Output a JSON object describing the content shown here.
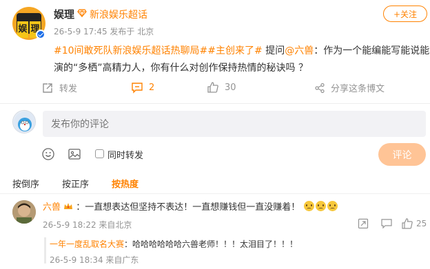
{
  "header": {
    "avatar_chars": [
      "娱",
      "理"
    ],
    "username": "娱理",
    "badge": "新浪娱乐超话",
    "meta": "26-5-9 17:45  发布于 北京",
    "follow_label": "+关注"
  },
  "post": {
    "tag": "#10间敢死队新浪娱乐超话热聊局##主创来了#",
    "text_a": " 提问",
    "mention": "@六兽",
    "text_b": "：作为一个能编能写能说能演的“多栖”高精力人，你有什么对创作保持热情的秘诀吗 ？"
  },
  "actions": {
    "repost_label": "转发",
    "comment_count": "2",
    "like_count": "30",
    "share_label": "分享这条博文"
  },
  "compose": {
    "placeholder": "发布你的评论",
    "also_repost_label": "同时转发",
    "submit_label": "评论"
  },
  "sort": {
    "options": [
      "按倒序",
      "按正序",
      "按热度"
    ],
    "active": "按热度"
  },
  "comment": {
    "author": "六兽",
    "text": "：一直想表达但坚持不表达！一直想赚钱但一直没赚着！",
    "meta": "26-5-9 18:22  来自北京",
    "like_count": "25"
  },
  "reply": {
    "author": "一年一度乱取名大赛",
    "text": "：哈哈哈哈哈哈六兽老师！！！太泪目了！！！",
    "meta": "26-5-9 18:34  来自广东"
  },
  "colors": {
    "accent": "#ff8200",
    "verified": "#1e6fe8",
    "submit_disabled": "#ffc496"
  },
  "icons": [
    "verified-icon",
    "super-topic-icon",
    "repost-icon",
    "comment-icon",
    "like-icon",
    "share-icon",
    "emoji-icon",
    "image-icon",
    "report-icon",
    "reply-icon",
    "crown-badge-icon"
  ]
}
